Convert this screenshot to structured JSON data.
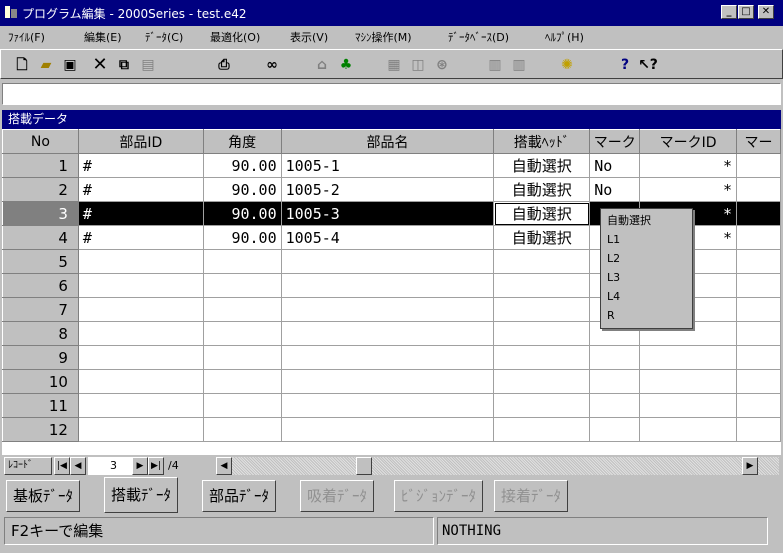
{
  "window": {
    "title": "プログラム編集 - 2000Series  - test.e42"
  },
  "menu": [
    "ﾌｧｲﾙ(F)",
    "編集(E)",
    "ﾃﾞｰﾀ(C)",
    "最適化(O)",
    "表示(V)",
    "ﾏｼﾝ操作(M)",
    "ﾃﾞｰﾀﾍﾞｰｽ(D)",
    "ﾍﾙﾌﾟ(H)"
  ],
  "panel": {
    "title": "搭載データ"
  },
  "columns": [
    "No",
    "部品ID",
    "角度",
    "部品名",
    "搭載ﾍｯﾄﾞ",
    "マーク",
    "マークID",
    "マー"
  ],
  "rows": [
    {
      "no": "1",
      "id": "#",
      "angle": "90.00",
      "name": "1005-1",
      "head": "自動選択",
      "mark": "No",
      "markid": "*"
    },
    {
      "no": "2",
      "id": "#",
      "angle": "90.00",
      "name": "1005-2",
      "head": "自動選択",
      "mark": "No",
      "markid": "*"
    },
    {
      "no": "3",
      "id": "#",
      "angle": "90.00",
      "name": "1005-3",
      "head": "自動選択",
      "mark": "",
      "markid": "*"
    },
    {
      "no": "4",
      "id": "#",
      "angle": "90.00",
      "name": "1005-4",
      "head": "自動選択",
      "mark": "",
      "markid": "*"
    },
    {
      "no": "5"
    },
    {
      "no": "6"
    },
    {
      "no": "7"
    },
    {
      "no": "8"
    },
    {
      "no": "9"
    },
    {
      "no": "10"
    },
    {
      "no": "11"
    },
    {
      "no": "12"
    }
  ],
  "dropdown": [
    "自動選択",
    "L1",
    "L2",
    "L3",
    "L4",
    "R"
  ],
  "navigator": {
    "label": "ﾚｺｰﾄﾞ",
    "current": "3",
    "total": "/4"
  },
  "tabs": [
    "基板ﾃﾞｰﾀ",
    "搭載ﾃﾞｰﾀ",
    "部品ﾃﾞｰﾀ",
    "吸着ﾃﾞｰﾀ",
    "ﾋﾞｼﾞｮﾝﾃﾞｰﾀ",
    "接着ﾃﾞｰﾀ"
  ],
  "status": {
    "left": "F2キーで編集",
    "right": "NOTHING"
  },
  "toolbar_icons": [
    "new-icon",
    "open-icon",
    "save-icon",
    "cut-icon",
    "copy-icon",
    "paste-icon",
    "print-icon",
    "find-icon",
    "optimize-icon",
    "nozzle-icon",
    "image-icon",
    "chart-icon",
    "part-icon",
    "machine-icon",
    "machine2-icon",
    "bulb-icon",
    "help-icon",
    "context-help-icon"
  ]
}
